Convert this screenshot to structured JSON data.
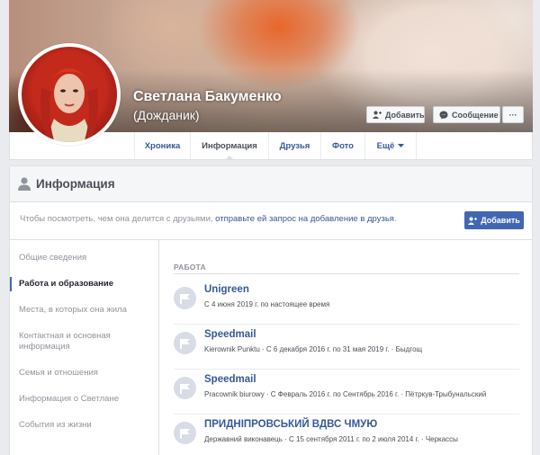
{
  "profile": {
    "name": "Светлана Бакуменко",
    "alternate_name": "(Дождaник)"
  },
  "cover_actions": {
    "add_friend": "Добавить",
    "message": "Сообщение",
    "more": "···"
  },
  "nav": {
    "tabs": [
      {
        "label": "Хроника"
      },
      {
        "label": "Информация"
      },
      {
        "label": "Друзья"
      },
      {
        "label": "Фото"
      },
      {
        "label": "Ещё"
      }
    ]
  },
  "info_card": {
    "title": "Информация",
    "request_text": "Чтобы посмотреть, чем она делится с друзьями, ",
    "request_link": "отправьте ей запрос на добавление в друзья",
    "request_end": ".",
    "request_button": "Добавить"
  },
  "sidebar": {
    "items": [
      {
        "label": "Общие сведения"
      },
      {
        "label": "Работа и образование"
      },
      {
        "label": "Места, в которых она жила"
      },
      {
        "label": "Контактная и основная информация"
      },
      {
        "label": "Семья и отношения"
      },
      {
        "label": "Информация о Светлане"
      },
      {
        "label": "События из жизни"
      }
    ]
  },
  "work": {
    "section_label": "РАБОТА",
    "jobs": [
      {
        "name": "Unigreen",
        "meta": "С 4 июня 2019 г. по настоящее время"
      },
      {
        "name": "Speedmail",
        "meta": "Kierownik Punktu · С 6 декабря 2016 г. по 31 мая 2019 г. · Быдгощ"
      },
      {
        "name": "Speedmail",
        "meta": "Pracownik biurowy · С Февраль 2016 г. по Сентябрь 2016 г. · Пётркув-Трыбунальский"
      },
      {
        "name": "ПРИДНІПРОВСЬКИЙ ВДВС ЧМУЮ",
        "meta": "Державний виконавець · С 15 сентября 2011 г. по 2 июля 2014 г. · Черкассы"
      }
    ]
  },
  "colors": {
    "link": "#365899",
    "primary_button": "#4267b2",
    "page_background": "#e9ebee"
  }
}
